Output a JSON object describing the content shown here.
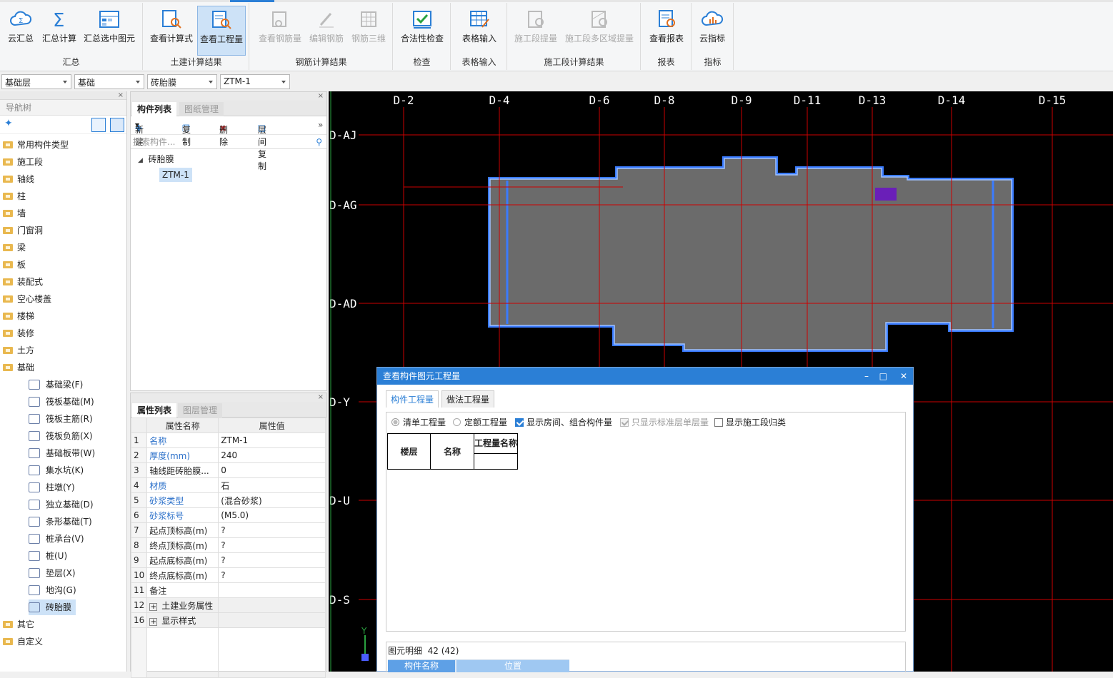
{
  "ribbon": {
    "groups": [
      {
        "label": "汇总",
        "buttons": [
          "云汇总",
          "汇总计算",
          "汇总选中图元"
        ]
      },
      {
        "label": "土建计算结果",
        "buttons": [
          "查看计算式",
          "查看工程量"
        ]
      },
      {
        "label": "钢筋计算结果",
        "buttons": [
          "查看钢筋量",
          "编辑钢筋",
          "钢筋三维"
        ]
      },
      {
        "label": "检查",
        "buttons": [
          "合法性检查"
        ]
      },
      {
        "label": "表格输入",
        "buttons": [
          "表格输入"
        ]
      },
      {
        "label": "施工段计算结果",
        "buttons": [
          "施工段提量",
          "施工段多区域提量"
        ]
      },
      {
        "label": "报表",
        "buttons": [
          "查看报表"
        ]
      },
      {
        "label": "指标",
        "buttons": [
          "云指标"
        ]
      }
    ]
  },
  "selectors": {
    "floor": "基础层",
    "category": "基础",
    "type": "砖胎膜",
    "component": "ZTM-1"
  },
  "nav": {
    "title": "导航树",
    "items": [
      "常用构件类型",
      "施工段",
      "轴线",
      "柱",
      "墙",
      "门窗洞",
      "梁",
      "板",
      "装配式",
      "空心楼盖",
      "楼梯",
      "装修",
      "土方",
      "基础"
    ],
    "sub_items": [
      "基础梁(F)",
      "筏板基础(M)",
      "筏板主筋(R)",
      "筏板负筋(X)",
      "基础板带(W)",
      "集水坑(K)",
      "柱墩(Y)",
      "独立基础(D)",
      "条形基础(T)",
      "桩承台(V)",
      "桩(U)",
      "垫层(X)",
      "地沟(G)",
      "砖胎膜"
    ],
    "tail_items": [
      "其它",
      "自定义"
    ]
  },
  "component_panel": {
    "tabs": [
      "构件列表",
      "图纸管理"
    ],
    "toolbar": {
      "new": "新建",
      "copy": "复制",
      "delete": "删除",
      "floor_copy": "层间复制"
    },
    "search_placeholder": "搜索构件...",
    "tree_root": "砖胎膜",
    "tree_child": "ZTM-1"
  },
  "props_panel": {
    "tabs": [
      "属性列表",
      "图层管理"
    ],
    "headers": [
      "属性名称",
      "属性值"
    ],
    "rows": [
      {
        "n": "1",
        "name": "名称",
        "value": "ZTM-1",
        "blue": true
      },
      {
        "n": "2",
        "name": "厚度(mm)",
        "value": "240",
        "blue": true
      },
      {
        "n": "3",
        "name": "轴线距砖胎膜...",
        "value": "0",
        "blue": false
      },
      {
        "n": "4",
        "name": "材质",
        "value": "石",
        "blue": true
      },
      {
        "n": "5",
        "name": "砂浆类型",
        "value": "(混合砂浆)",
        "blue": true
      },
      {
        "n": "6",
        "name": "砂浆标号",
        "value": "(M5.0)",
        "blue": true
      },
      {
        "n": "7",
        "name": "起点顶标高(m)",
        "value": "?",
        "blue": false
      },
      {
        "n": "8",
        "name": "终点顶标高(m)",
        "value": "?",
        "blue": false
      },
      {
        "n": "9",
        "name": "起点底标高(m)",
        "value": "?",
        "blue": false
      },
      {
        "n": "10",
        "name": "终点底标高(m)",
        "value": "?",
        "blue": false
      },
      {
        "n": "11",
        "name": "备注",
        "value": "",
        "blue": false
      },
      {
        "n": "12",
        "name": "土建业务属性",
        "value": "",
        "blue": false,
        "group": true
      },
      {
        "n": "16",
        "name": "显示样式",
        "value": "",
        "blue": false,
        "group": true
      }
    ]
  },
  "canvas": {
    "top_axes": [
      "D-2",
      "D-4",
      "D-6",
      "D-8",
      "D-9",
      "D-11",
      "D-13",
      "D-14",
      "D-15"
    ],
    "left_axes": [
      "D-AJ",
      "D-AG",
      "D-AD",
      "D-Y",
      "D-U",
      "D-S"
    ],
    "axis_y_label": "Y",
    "colors": {
      "background": "#000000",
      "axis": "#cc0000",
      "slab": "#6b6b6b",
      "edge": "#3a7bff",
      "highlight": "#6a1fb8"
    }
  },
  "dialog": {
    "title": "查看构件图元工程量",
    "tabs": [
      "构件工程量",
      "做法工程量"
    ],
    "options": {
      "list_qty": "清单工程量",
      "quota_qty": "定额工程量",
      "show_rooms": "显示房间、组合构件量",
      "only_std_floor": "只显示标准层单层量",
      "show_section": "显示施工段归类"
    },
    "table_headers": [
      "楼层",
      "名称",
      "工程量名称"
    ],
    "detail_label": "图元明细",
    "detail_count": "42 (42)",
    "detail_headers": [
      "构件名称",
      "位置"
    ]
  }
}
